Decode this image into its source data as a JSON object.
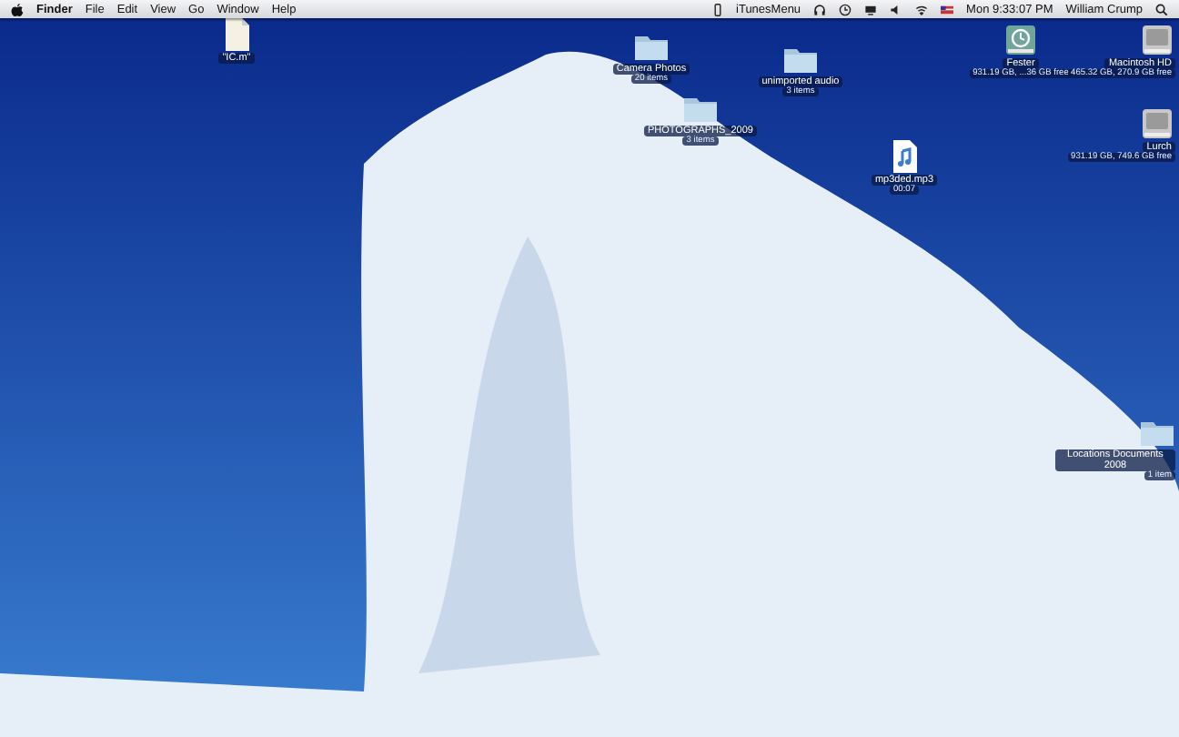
{
  "menu_bar": {
    "app_name": "Finder",
    "menus": [
      "File",
      "Edit",
      "View",
      "Go",
      "Window",
      "Help"
    ],
    "status_text": "iTunesMenu",
    "clock": "Mon 9:33:07 PM",
    "user": "William Crump"
  },
  "desktop_icons": [
    {
      "kind": "document",
      "name": "\"IC.m\""
    },
    {
      "kind": "folder",
      "name": "Camera Photos",
      "info": "20 items"
    },
    {
      "kind": "folder",
      "name": "unimported audio",
      "info": "3 items"
    },
    {
      "kind": "folder",
      "name": "PHOTOGRAPHS_2009",
      "info": "3 items"
    },
    {
      "kind": "audio",
      "name": "mp3ded.mp3",
      "info": "00:07"
    },
    {
      "kind": "timemachine",
      "name": "Fester",
      "info": "931.19 GB, ...36 GB free"
    },
    {
      "kind": "disk",
      "name": "Macintosh HD",
      "info": "465.32 GB, 270.9 GB free"
    },
    {
      "kind": "disk",
      "name": "Lurch",
      "info": "931.19 GB, 749.6 GB free"
    },
    {
      "kind": "folder",
      "name": "Locations Documents 2008",
      "info": "1 item"
    }
  ]
}
